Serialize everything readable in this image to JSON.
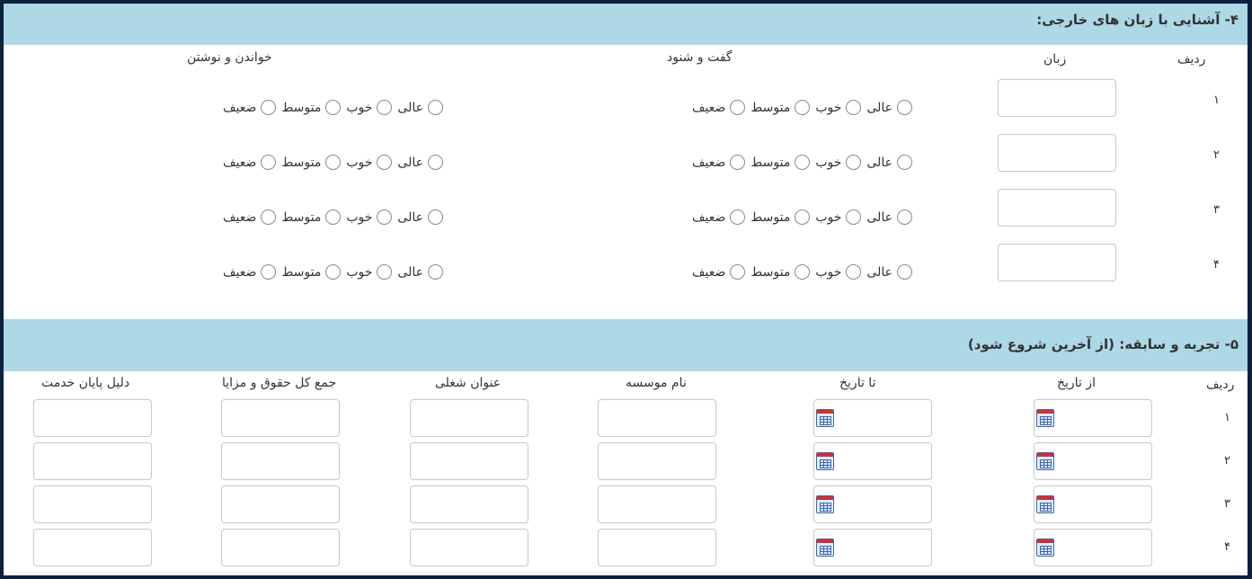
{
  "languages": {
    "title": "۴- آشنایی با زبان های خارجی:",
    "headers": {
      "row": "ردیف",
      "language": "زبان",
      "speaking": "گفت و شنود",
      "reading_writing": "خواندن و نوشتن"
    },
    "levels": [
      "عالی",
      "خوب",
      "متوسط",
      "ضعیف"
    ],
    "rows": [
      {
        "num": "۱",
        "language": ""
      },
      {
        "num": "۲",
        "language": ""
      },
      {
        "num": "۳",
        "language": ""
      },
      {
        "num": "۴",
        "language": ""
      }
    ]
  },
  "experience": {
    "title": "۵- تجربه و سابقه: (از آخرین شروع شود)",
    "headers": {
      "row": "ردیف",
      "from_date": "از تاریخ",
      "to_date": "تا تاریخ",
      "institution": "نام موسسه",
      "job_title": "عنوان شغلی",
      "total_salary": "جمع کل حقوق و مزایا",
      "end_reason": "دلیل پایان خدمت"
    },
    "rows": [
      {
        "num": "۱"
      },
      {
        "num": "۲"
      },
      {
        "num": "۳"
      },
      {
        "num": "۴"
      }
    ]
  },
  "icons": {
    "date_picker": "calendar-icon"
  },
  "colors": {
    "section_bar": "#add8e6",
    "frame": "#0d2140",
    "calendar_top": "#d03030",
    "calendar_grid": "#3a66b0"
  }
}
